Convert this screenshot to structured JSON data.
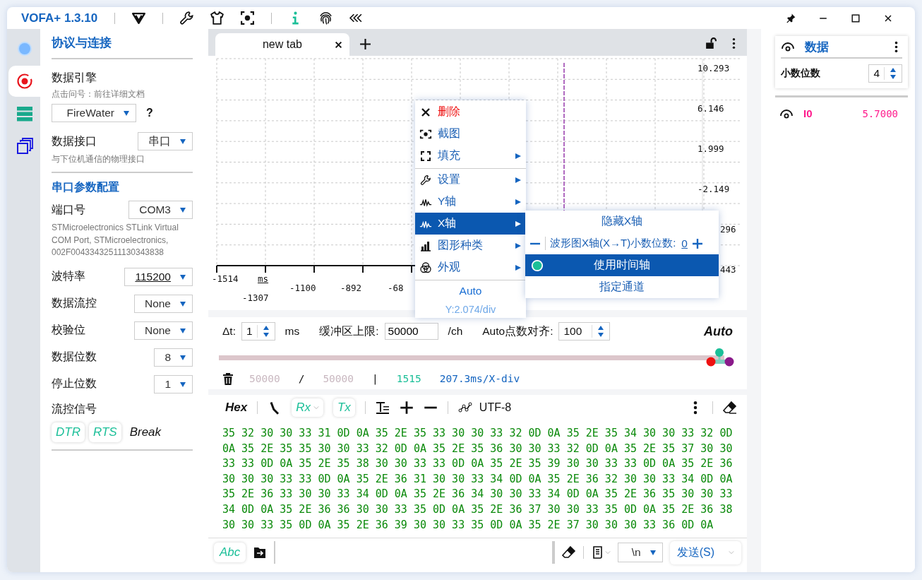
{
  "window": {
    "title": "VOFA+ 1.3.10"
  },
  "rail": [
    {
      "kind": "status",
      "selected": false
    },
    {
      "kind": "record",
      "selected": true
    },
    {
      "kind": "list",
      "selected": false
    },
    {
      "kind": "windows",
      "selected": false
    }
  ],
  "sidebar": {
    "title": "协议与连接",
    "engine": {
      "label": "数据引擎",
      "hint": "点击问号：前往详细文档",
      "value": "FireWater",
      "help": "?"
    },
    "interface": {
      "label": "数据接口",
      "value": "串口",
      "hint": "与下位机通信的物理接口"
    },
    "serial_title": "串口参数配置",
    "port": {
      "label": "端口号",
      "value": "COM3",
      "description": "STMicroelectronics STLink Virtual COM Port, STMicroelectronics, 002F00433432511130343838"
    },
    "params": [
      {
        "label": "波特率",
        "value": "115200",
        "underlined": true
      },
      {
        "label": "数据流控",
        "value": "None",
        "underlined": false
      },
      {
        "label": "校验位",
        "value": "None",
        "underlined": false
      },
      {
        "label": "数据位数",
        "value": "8",
        "underlined": false
      },
      {
        "label": "停止位数",
        "value": "1",
        "underlined": false
      }
    ],
    "flow_signals": {
      "label": "流控信号",
      "buttons": [
        {
          "label": "DTR",
          "on": true
        },
        {
          "label": "RTS",
          "on": true
        },
        {
          "label": "Break",
          "on": false
        }
      ]
    }
  },
  "tabs": [
    {
      "label": "new tab",
      "selected": true
    }
  ],
  "chart": {
    "y_labels": [
      "10.293",
      "6.146",
      "1.999",
      "-2.149",
      "296",
      "443"
    ],
    "x_labels": [
      "-1514",
      "ms",
      "-1307",
      "-1100",
      "-892",
      "-68"
    ]
  },
  "context_menu": {
    "items": [
      {
        "kind": "close",
        "label": "删除",
        "danger": true,
        "submenu": false,
        "selected": false,
        "divider_before": false
      },
      {
        "kind": "capture",
        "label": "截图",
        "danger": false,
        "submenu": false,
        "selected": false,
        "divider_before": false
      },
      {
        "kind": "fill",
        "label": "填充",
        "danger": false,
        "submenu": true,
        "selected": false,
        "divider_before": false
      },
      {
        "kind": "wrench",
        "label": "设置",
        "danger": false,
        "submenu": true,
        "selected": false,
        "divider_before": true
      },
      {
        "kind": "wave",
        "label": "Y轴",
        "danger": false,
        "submenu": true,
        "selected": false,
        "divider_before": false
      },
      {
        "kind": "wave",
        "label": "X轴",
        "danger": false,
        "submenu": true,
        "selected": true,
        "divider_before": false
      },
      {
        "kind": "bars",
        "label": "图形种类",
        "danger": false,
        "submenu": true,
        "selected": false,
        "divider_before": false
      },
      {
        "kind": "circles",
        "label": "外观",
        "danger": false,
        "submenu": true,
        "selected": false,
        "divider_before": false
      }
    ],
    "footer": [
      "Auto",
      "Y:2.074/div"
    ]
  },
  "submenu": {
    "items": [
      {
        "kind": "action",
        "label": "隐藏X轴",
        "selected": false
      },
      {
        "kind": "stepper",
        "label": "波形图X轴(X→T)小数位数:",
        "value": "0",
        "selected": false
      },
      {
        "kind": "radio",
        "label": "使用时间轴",
        "selected": true,
        "checked": true
      },
      {
        "kind": "action",
        "label": "指定通道",
        "selected": false
      }
    ]
  },
  "acquisition": {
    "dt": {
      "label": "Δt:",
      "value": "1",
      "unit": "ms"
    },
    "buffer": {
      "label": "缓冲区上限:",
      "value": "50000",
      "unit": "/ch"
    },
    "align": {
      "label": "Auto点数对齐:",
      "value": "100"
    },
    "mode": "Auto"
  },
  "slider": {
    "level": 1
  },
  "stats": {
    "used": "50000",
    "separator": "/",
    "capacity": "50000",
    "divider": "|",
    "points": "1515",
    "scale": "207.3ms/X-div"
  },
  "terminal_toolbar": {
    "hex": "Hex",
    "rx": {
      "label": "Rx",
      "on": true
    },
    "tx": {
      "label": "Tx",
      "on": true
    },
    "encoding": "UTF-8"
  },
  "hex_lines": [
    "35 32 30 30 33 31 0D 0A 35 2E 35 33 30 30 33 32 0D 0A 35 2E 35 34 30 30 33 32 0D",
    "0A 35 2E 35 35 30 30 33 32 0D 0A 35 2E 35 36 30 30 33 32 0D 0A 35 2E 35 37 30 30",
    "33 33 0D 0A 35 2E 35 38 30 30 33 33 0D 0A 35 2E 35 39 30 30 33 33 0D 0A 35 2E 36",
    "30 30 30 33 33 0D 0A 35 2E 36 31 30 30 33 34 0D 0A 35 2E 36 32 30 30 33 34 0D 0A",
    "35 2E 36 33 30 30 33 34 0D 0A 35 2E 36 34 30 30 33 34 0D 0A 35 2E 36 35 30 30 33",
    "34 0D 0A 35 2E 36 36 30 30 33 35 0D 0A 35 2E 36 37 30 30 33 35 0D 0A 35 2E 36 38",
    "30 30 33 35 0D 0A 35 2E 36 39 30 30 33 35 0D 0A 35 2E 37 30 30 30 33 36 0D 0A"
  ],
  "send_bar": {
    "mode": "Abc",
    "line_ending": "\\n",
    "send": "发送(S)"
  },
  "data_panel": {
    "title": "数据",
    "decimals": {
      "label": "小数位数",
      "value": "4"
    },
    "channels": [
      {
        "name": "I0",
        "value": "5.7000",
        "color": "#ff1a8c"
      }
    ]
  }
}
